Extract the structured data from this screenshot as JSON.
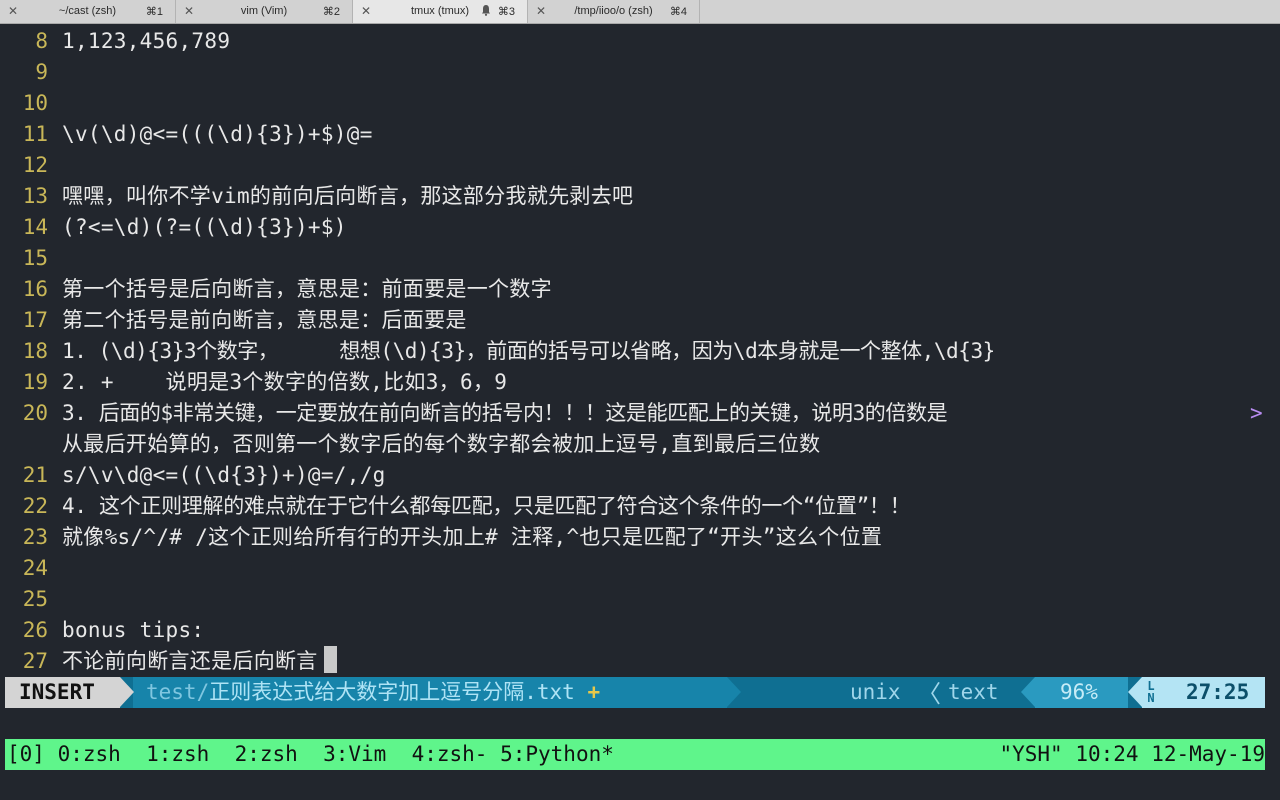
{
  "tabs": [
    {
      "close": "✕",
      "title": "~/cast (zsh)",
      "shortcut": "⌘1",
      "active": false
    },
    {
      "close": "✕",
      "title": "vim (Vim)",
      "shortcut": "⌘2",
      "active": false
    },
    {
      "close": "✕",
      "title": "tmux (tmux)",
      "shortcut": "⌘3",
      "active": true,
      "bell": true
    },
    {
      "close": "✕",
      "title": "/tmp/iioo/o (zsh)",
      "shortcut": "⌘4",
      "active": false
    }
  ],
  "editor": {
    "lines": [
      {
        "n": "8",
        "text": "1,123,456,789"
      },
      {
        "n": "9",
        "text": ""
      },
      {
        "n": "10",
        "text": ""
      },
      {
        "n": "11",
        "text": "\\v(\\d)@<=(((\\d){3})+$)@="
      },
      {
        "n": "12",
        "text": ""
      },
      {
        "n": "13",
        "text": "嘿嘿，叫你不学vim的前向后向断言，那这部分我就先剥去吧"
      },
      {
        "n": "14",
        "text": "(?<=\\d)(?=((\\d){3})+$)"
      },
      {
        "n": "15",
        "text": ""
      },
      {
        "n": "16",
        "text": "第一个括号是后向断言，意思是：前面要是一个数字"
      },
      {
        "n": "17",
        "text": "第二个括号是前向断言，意思是：后面要是"
      },
      {
        "n": "18",
        "text": "1. (\\d){3}3个数字，     想想(\\d){3}，前面的括号可以省略，因为\\d本身就是一个整体,\\d{3}"
      },
      {
        "n": "19",
        "text": "2. +    说明是3个数字的倍数,比如3，6，9"
      },
      {
        "n": "20",
        "text": "3. 后面的$非常关键，一定要放在前向断言的括号内！！！这是能匹配上的关键，说明3的倍数是"
      },
      {
        "n": "",
        "text": "从最后开始算的，否则第一个数字后的每个数字都会被加上逗号,直到最后三位数"
      },
      {
        "n": "21",
        "text": "s/\\v\\d@<=((\\d{3})+)@=/,/g"
      },
      {
        "n": "22",
        "text": "4. 这个正则理解的难点就在于它什么都每匹配，只是匹配了符合这个条件的一个“位置”！！"
      },
      {
        "n": "23",
        "text": "就像%s/^/# /这个正则给所有行的开头加上# 注释,^也只是匹配了“开头”这么个位置"
      },
      {
        "n": "24",
        "text": ""
      },
      {
        "n": "25",
        "text": ""
      },
      {
        "n": "26",
        "text": "bonus tips:"
      },
      {
        "n": "27",
        "text": "不论前向断言还是后向断言"
      }
    ],
    "wrap_marker": ">"
  },
  "statusline": {
    "mode": "INSERT",
    "dir": "test/",
    "file": "正则表达式给大数字加上逗号分隔.txt",
    "modified": "+",
    "fileformat": "unix",
    "sep": "〈",
    "filetype": "text",
    "percent": "96%",
    "ln_icon_top": "L",
    "ln_icon_bottom": "N",
    "position": "27:25"
  },
  "tmux": {
    "left": "[0] 0:zsh  1:zsh  2:zsh  3:Vim  4:zsh- 5:Python*",
    "right": "\"YSH\" 10:24 12-May-19"
  },
  "colors": {
    "background": "#22262d",
    "line_number": "#c9b758",
    "tmux_bar": "#5ff58b",
    "status_bg": "#0f6f92"
  }
}
